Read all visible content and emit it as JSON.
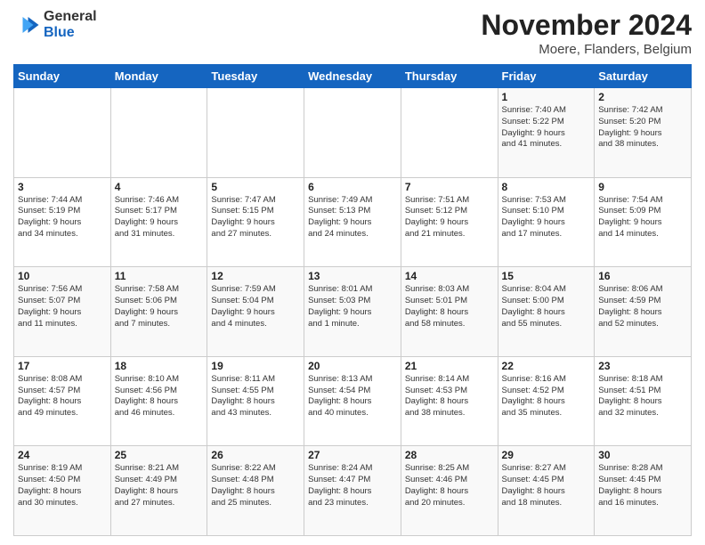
{
  "logo": {
    "text_general": "General",
    "text_blue": "Blue"
  },
  "title": "November 2024",
  "subtitle": "Moere, Flanders, Belgium",
  "days_header": [
    "Sunday",
    "Monday",
    "Tuesday",
    "Wednesday",
    "Thursday",
    "Friday",
    "Saturday"
  ],
  "weeks": [
    [
      {
        "day": "",
        "info": ""
      },
      {
        "day": "",
        "info": ""
      },
      {
        "day": "",
        "info": ""
      },
      {
        "day": "",
        "info": ""
      },
      {
        "day": "",
        "info": ""
      },
      {
        "day": "1",
        "info": "Sunrise: 7:40 AM\nSunset: 5:22 PM\nDaylight: 9 hours\nand 41 minutes."
      },
      {
        "day": "2",
        "info": "Sunrise: 7:42 AM\nSunset: 5:20 PM\nDaylight: 9 hours\nand 38 minutes."
      }
    ],
    [
      {
        "day": "3",
        "info": "Sunrise: 7:44 AM\nSunset: 5:19 PM\nDaylight: 9 hours\nand 34 minutes."
      },
      {
        "day": "4",
        "info": "Sunrise: 7:46 AM\nSunset: 5:17 PM\nDaylight: 9 hours\nand 31 minutes."
      },
      {
        "day": "5",
        "info": "Sunrise: 7:47 AM\nSunset: 5:15 PM\nDaylight: 9 hours\nand 27 minutes."
      },
      {
        "day": "6",
        "info": "Sunrise: 7:49 AM\nSunset: 5:13 PM\nDaylight: 9 hours\nand 24 minutes."
      },
      {
        "day": "7",
        "info": "Sunrise: 7:51 AM\nSunset: 5:12 PM\nDaylight: 9 hours\nand 21 minutes."
      },
      {
        "day": "8",
        "info": "Sunrise: 7:53 AM\nSunset: 5:10 PM\nDaylight: 9 hours\nand 17 minutes."
      },
      {
        "day": "9",
        "info": "Sunrise: 7:54 AM\nSunset: 5:09 PM\nDaylight: 9 hours\nand 14 minutes."
      }
    ],
    [
      {
        "day": "10",
        "info": "Sunrise: 7:56 AM\nSunset: 5:07 PM\nDaylight: 9 hours\nand 11 minutes."
      },
      {
        "day": "11",
        "info": "Sunrise: 7:58 AM\nSunset: 5:06 PM\nDaylight: 9 hours\nand 7 minutes."
      },
      {
        "day": "12",
        "info": "Sunrise: 7:59 AM\nSunset: 5:04 PM\nDaylight: 9 hours\nand 4 minutes."
      },
      {
        "day": "13",
        "info": "Sunrise: 8:01 AM\nSunset: 5:03 PM\nDaylight: 9 hours\nand 1 minute."
      },
      {
        "day": "14",
        "info": "Sunrise: 8:03 AM\nSunset: 5:01 PM\nDaylight: 8 hours\nand 58 minutes."
      },
      {
        "day": "15",
        "info": "Sunrise: 8:04 AM\nSunset: 5:00 PM\nDaylight: 8 hours\nand 55 minutes."
      },
      {
        "day": "16",
        "info": "Sunrise: 8:06 AM\nSunset: 4:59 PM\nDaylight: 8 hours\nand 52 minutes."
      }
    ],
    [
      {
        "day": "17",
        "info": "Sunrise: 8:08 AM\nSunset: 4:57 PM\nDaylight: 8 hours\nand 49 minutes."
      },
      {
        "day": "18",
        "info": "Sunrise: 8:10 AM\nSunset: 4:56 PM\nDaylight: 8 hours\nand 46 minutes."
      },
      {
        "day": "19",
        "info": "Sunrise: 8:11 AM\nSunset: 4:55 PM\nDaylight: 8 hours\nand 43 minutes."
      },
      {
        "day": "20",
        "info": "Sunrise: 8:13 AM\nSunset: 4:54 PM\nDaylight: 8 hours\nand 40 minutes."
      },
      {
        "day": "21",
        "info": "Sunrise: 8:14 AM\nSunset: 4:53 PM\nDaylight: 8 hours\nand 38 minutes."
      },
      {
        "day": "22",
        "info": "Sunrise: 8:16 AM\nSunset: 4:52 PM\nDaylight: 8 hours\nand 35 minutes."
      },
      {
        "day": "23",
        "info": "Sunrise: 8:18 AM\nSunset: 4:51 PM\nDaylight: 8 hours\nand 32 minutes."
      }
    ],
    [
      {
        "day": "24",
        "info": "Sunrise: 8:19 AM\nSunset: 4:50 PM\nDaylight: 8 hours\nand 30 minutes."
      },
      {
        "day": "25",
        "info": "Sunrise: 8:21 AM\nSunset: 4:49 PM\nDaylight: 8 hours\nand 27 minutes."
      },
      {
        "day": "26",
        "info": "Sunrise: 8:22 AM\nSunset: 4:48 PM\nDaylight: 8 hours\nand 25 minutes."
      },
      {
        "day": "27",
        "info": "Sunrise: 8:24 AM\nSunset: 4:47 PM\nDaylight: 8 hours\nand 23 minutes."
      },
      {
        "day": "28",
        "info": "Sunrise: 8:25 AM\nSunset: 4:46 PM\nDaylight: 8 hours\nand 20 minutes."
      },
      {
        "day": "29",
        "info": "Sunrise: 8:27 AM\nSunset: 4:45 PM\nDaylight: 8 hours\nand 18 minutes."
      },
      {
        "day": "30",
        "info": "Sunrise: 8:28 AM\nSunset: 4:45 PM\nDaylight: 8 hours\nand 16 minutes."
      }
    ]
  ]
}
